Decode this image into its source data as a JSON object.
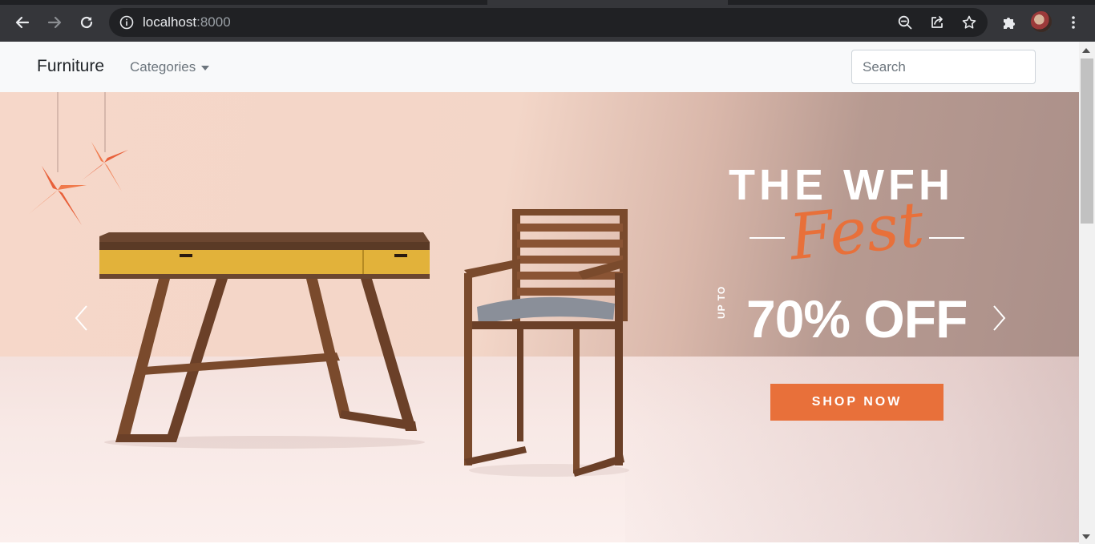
{
  "browser": {
    "url_host": "localhost",
    "url_port": ":8000",
    "icons": [
      "back-arrow-icon",
      "forward-arrow-icon",
      "reload-icon",
      "info-icon",
      "zoom-out-icon",
      "share-icon",
      "star-icon",
      "extensions-icon",
      "profile-avatar",
      "menu-dots-icon"
    ]
  },
  "navbar": {
    "brand": "Furniture",
    "categories_label": "Categories",
    "search_placeholder": "Search"
  },
  "carousel": {
    "title": "THE WFH",
    "script_title": "Fest",
    "up_to": "UP TO",
    "discount": "70% OFF",
    "cta_label": "SHOP NOW",
    "colors": {
      "accent": "#e8703a",
      "desk_top": "#e2b23a",
      "wood": "#7a4a2c",
      "seat": "#8a8f99"
    }
  }
}
